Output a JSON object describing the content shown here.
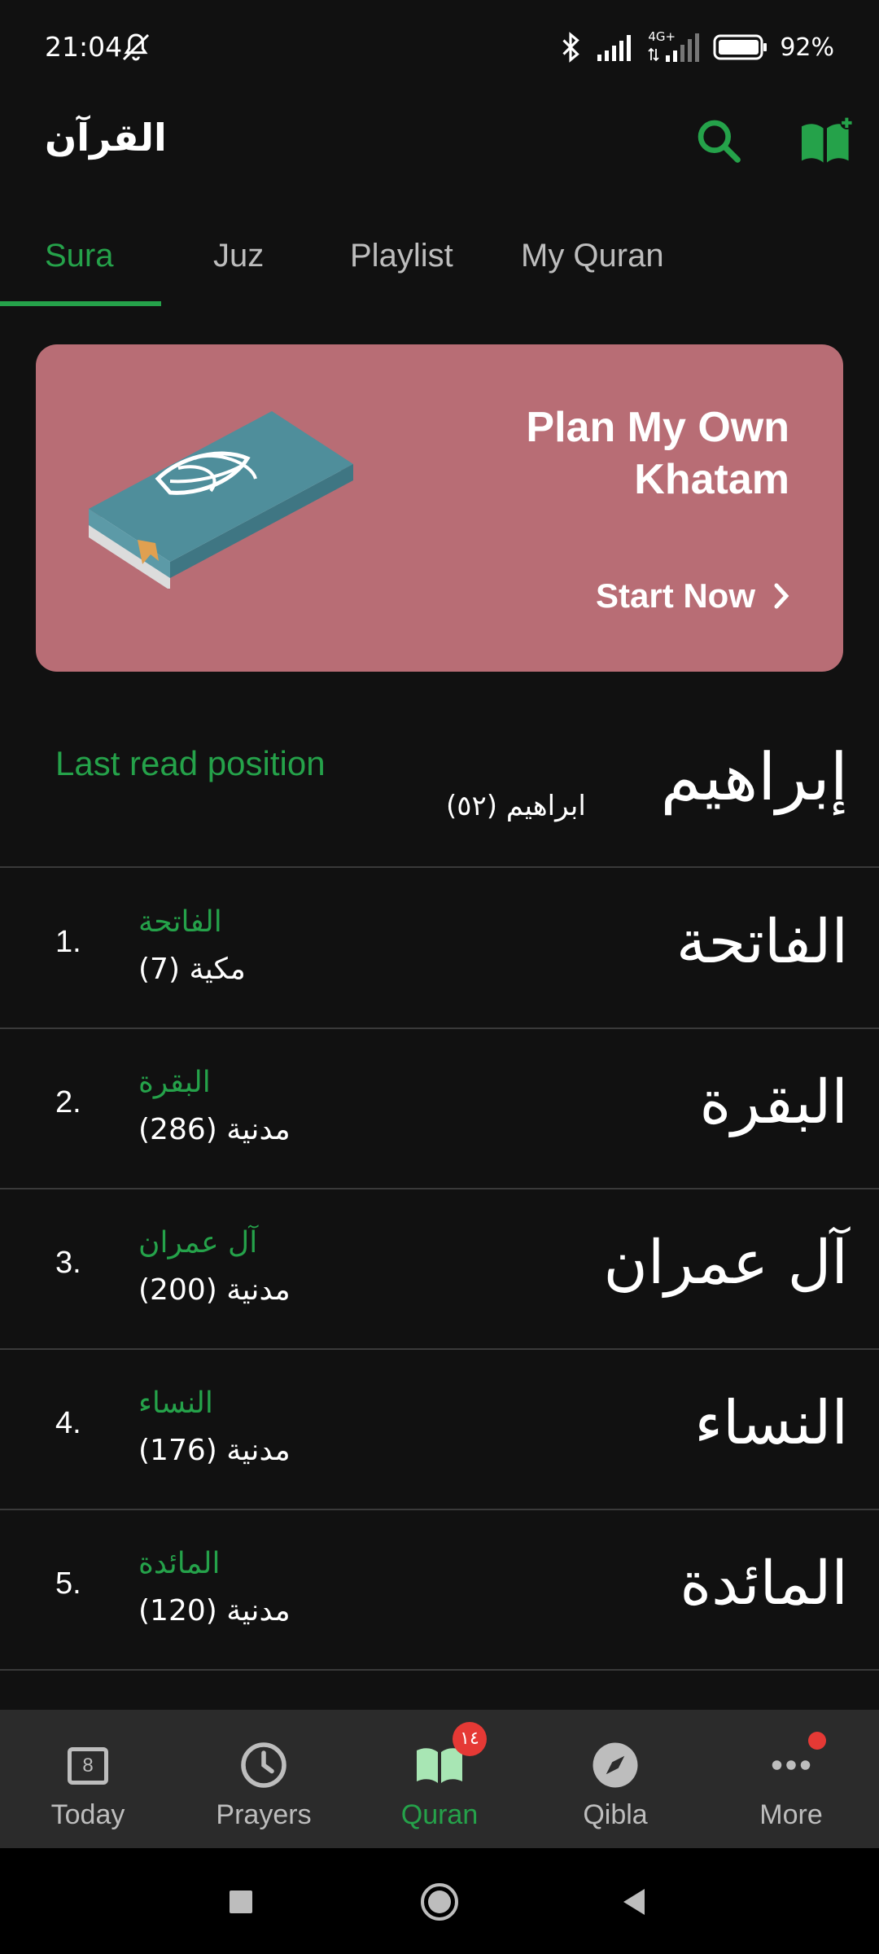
{
  "status_bar": {
    "time": "21:04",
    "network": "4G+",
    "battery": "92%"
  },
  "app_bar": {
    "title": "القرآن"
  },
  "tabs": [
    {
      "label": "Sura",
      "active": true
    },
    {
      "label": "Juz",
      "active": false
    },
    {
      "label": "Playlist",
      "active": false
    },
    {
      "label": "My Quran",
      "active": false
    }
  ],
  "banner": {
    "title": "Plan My Own Khatam",
    "cta": "Start Now"
  },
  "last_read": {
    "label": "Last read position",
    "sura": "ابراهيم (٥٢)",
    "calligraphy": "إبراهيم"
  },
  "suras": [
    {
      "number": "1.",
      "name": "الفاتحة",
      "meta": "مكية (7)",
      "calligraphy": "الفاتحة"
    },
    {
      "number": "2.",
      "name": "البقرة",
      "meta": "مدنية (286)",
      "calligraphy": "البقرة"
    },
    {
      "number": "3.",
      "name": "آل عمران",
      "meta": "مدنية (200)",
      "calligraphy": "آل عمران"
    },
    {
      "number": "4.",
      "name": "النساء",
      "meta": "مدنية (176)",
      "calligraphy": "النساء"
    },
    {
      "number": "5.",
      "name": "المائدة",
      "meta": "مدنية (120)",
      "calligraphy": "المائدة"
    }
  ],
  "bottom_nav": {
    "today": {
      "label": "Today",
      "day": "8"
    },
    "prayers": {
      "label": "Prayers"
    },
    "quran": {
      "label": "Quran",
      "badge": "١٤"
    },
    "qibla": {
      "label": "Qibla"
    },
    "more": {
      "label": "More"
    }
  },
  "colors": {
    "accent": "#25a24a",
    "background": "#111111",
    "banner": "#b86d75",
    "badge": "#e53935"
  }
}
